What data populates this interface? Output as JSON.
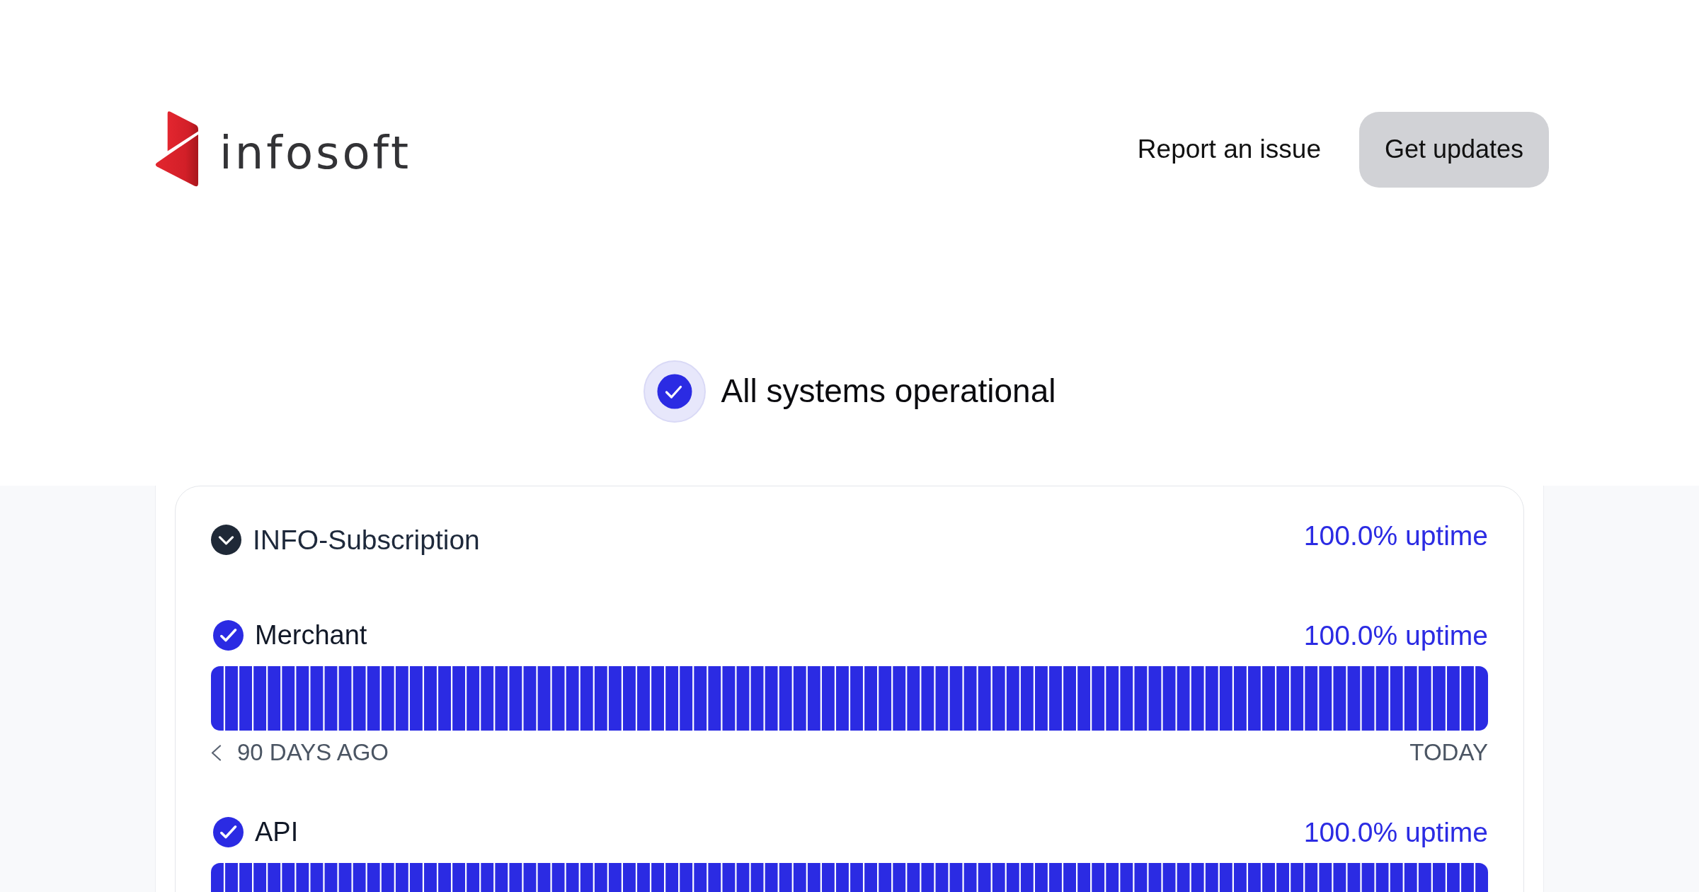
{
  "header": {
    "logo": {
      "text": "infosoft"
    },
    "links": [
      {
        "label": "Report an issue",
        "kind": "link"
      },
      {
        "label": "Get updates",
        "kind": "button"
      }
    ]
  },
  "overall_status": {
    "operational": true,
    "text": "All systems operational"
  },
  "groups": [
    {
      "name": "INFO-Subscription",
      "uptime": "100.0% uptime",
      "expanded": true,
      "children": [
        {
          "name": "Merchant",
          "operational": true,
          "uptime": "100.0% uptime",
          "range_start": "90 DAYS AGO",
          "range_end": "TODAY"
        },
        {
          "name": "API",
          "operational": true,
          "uptime": "100.0% uptime"
        }
      ]
    }
  ]
}
